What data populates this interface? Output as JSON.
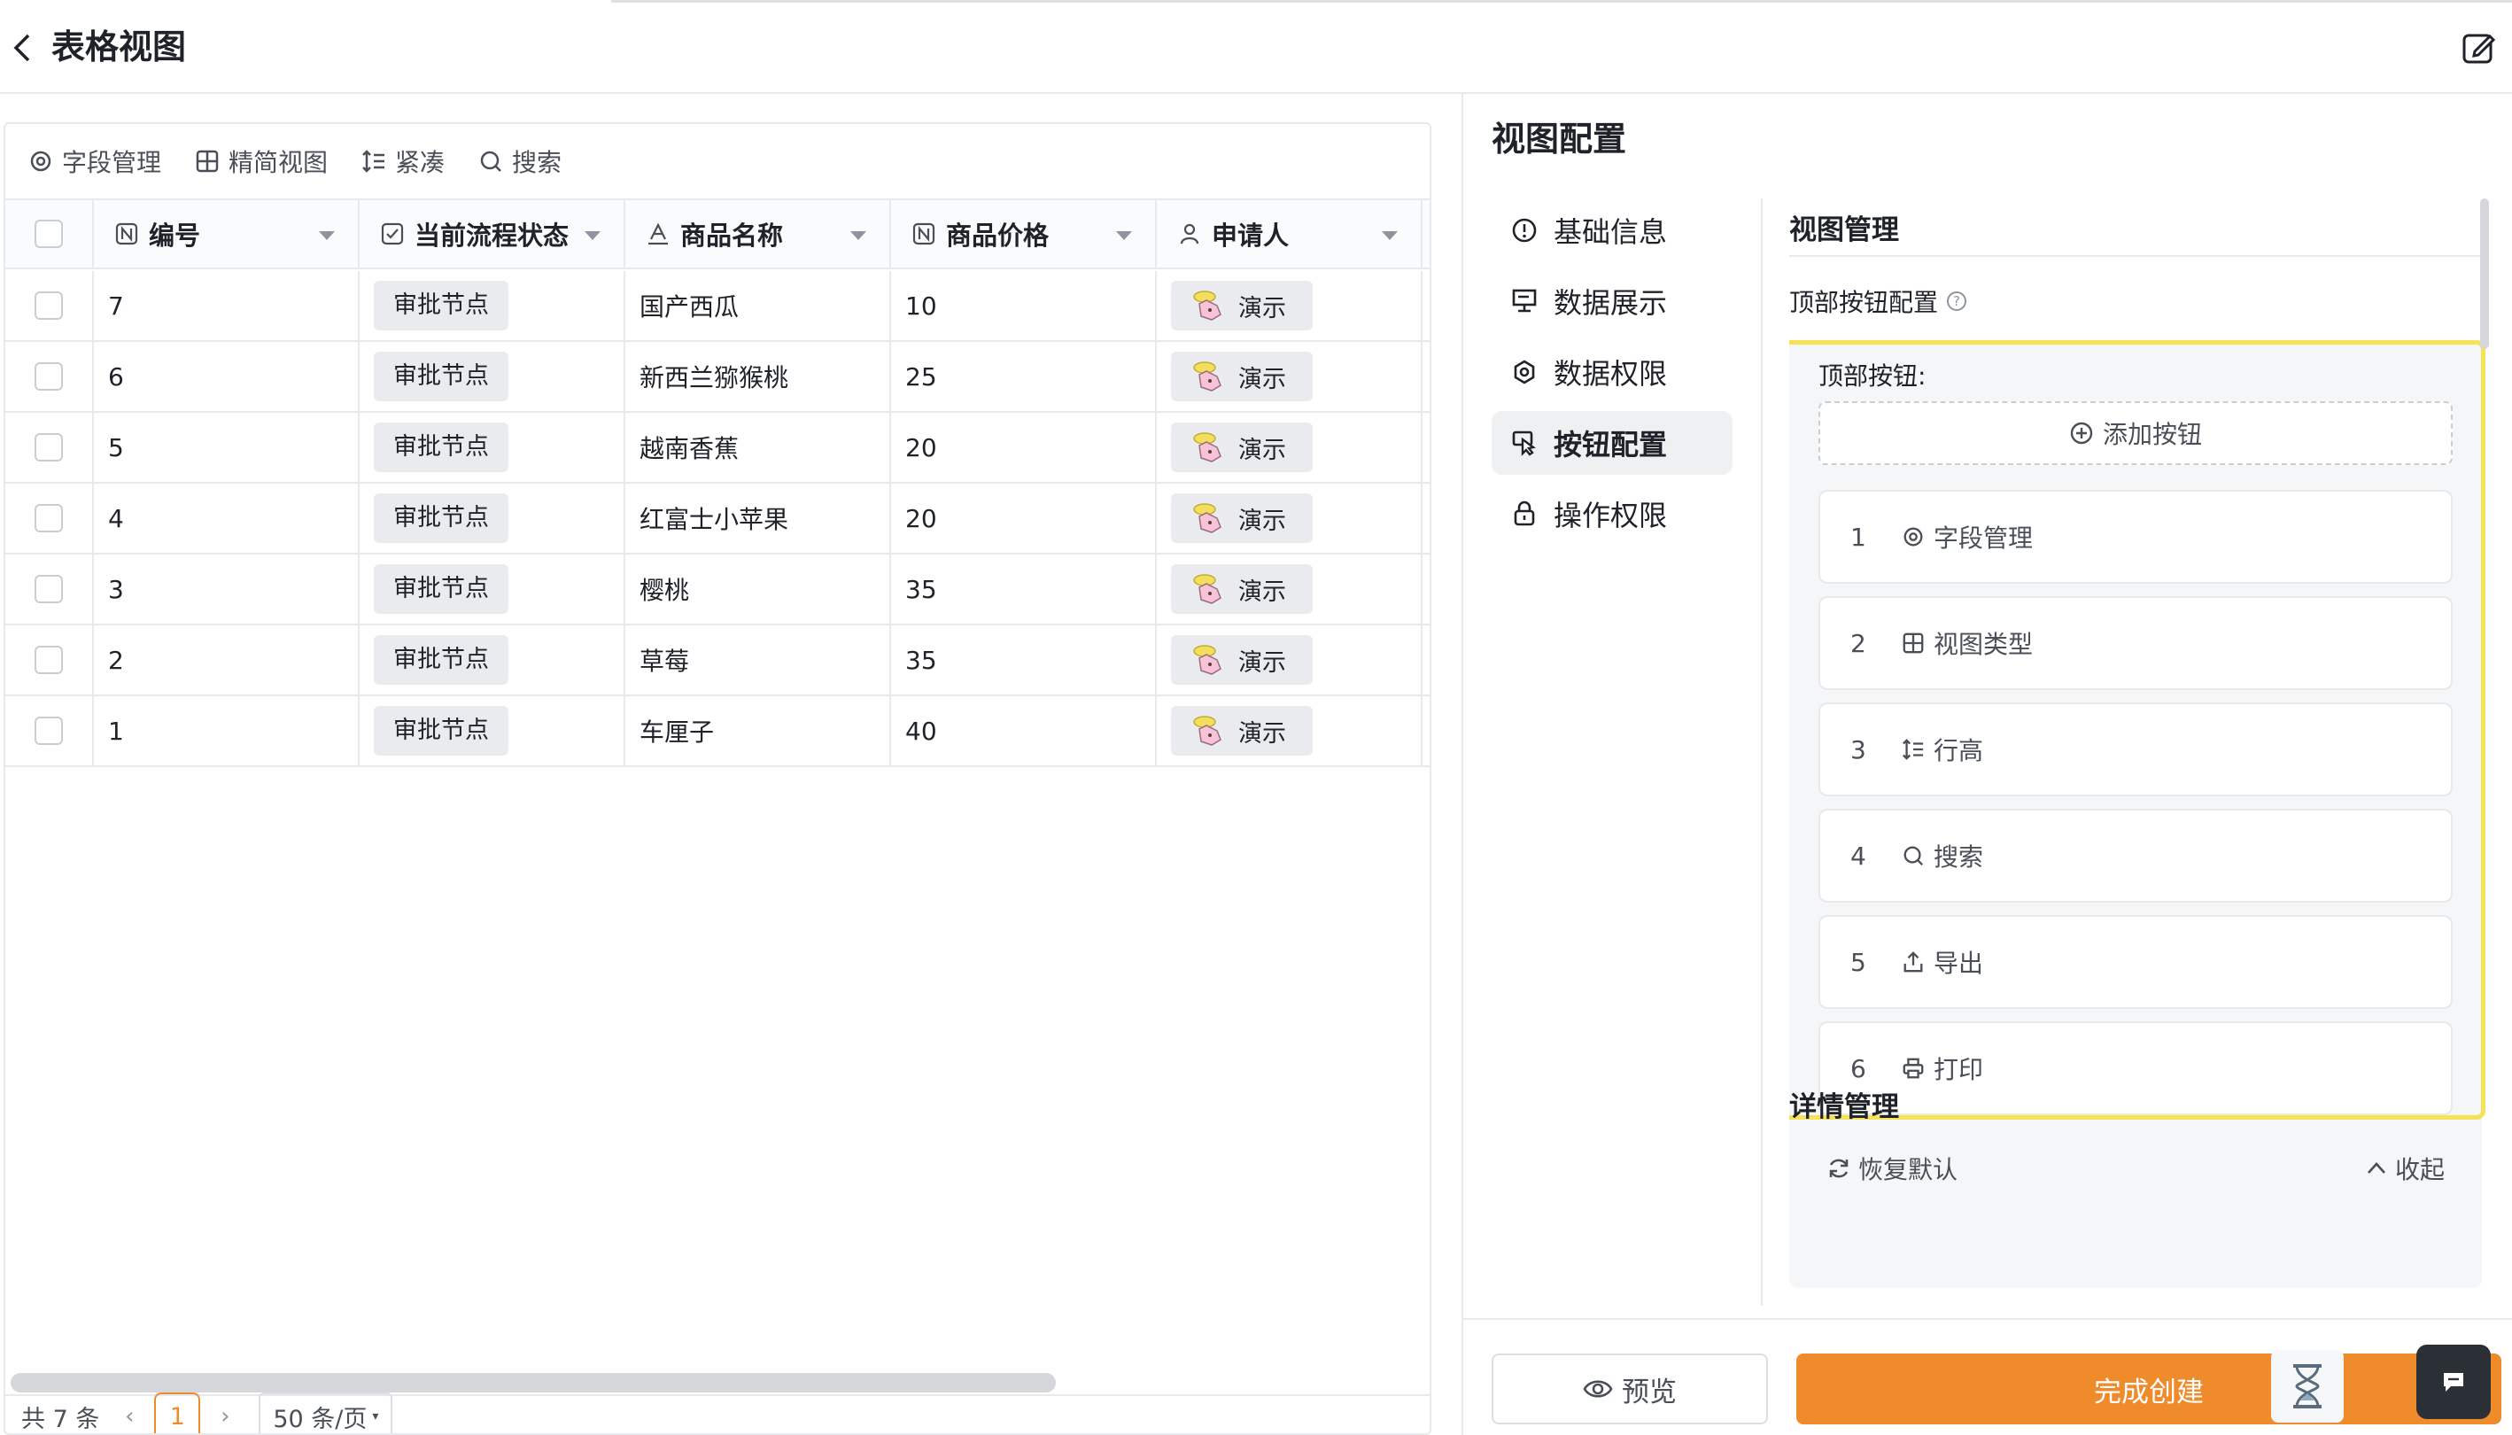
{
  "header": {
    "title": "表格视图"
  },
  "toolbar": {
    "items": [
      "字段管理",
      "精简视图",
      "紧凑",
      "搜索"
    ]
  },
  "table": {
    "columns": [
      "编号",
      "当前流程状态",
      "商品名称",
      "商品价格",
      "申请人"
    ],
    "rows": [
      {
        "id": "7",
        "status": "审批节点",
        "name": "国产西瓜",
        "price": "10",
        "applicant": "演示"
      },
      {
        "id": "6",
        "status": "审批节点",
        "name": "新西兰猕猴桃",
        "price": "25",
        "applicant": "演示"
      },
      {
        "id": "5",
        "status": "审批节点",
        "name": "越南香蕉",
        "price": "20",
        "applicant": "演示"
      },
      {
        "id": "4",
        "status": "审批节点",
        "name": "红富士小苹果",
        "price": "20",
        "applicant": "演示"
      },
      {
        "id": "3",
        "status": "审批节点",
        "name": "樱桃",
        "price": "35",
        "applicant": "演示"
      },
      {
        "id": "2",
        "status": "审批节点",
        "name": "草莓",
        "price": "35",
        "applicant": "演示"
      },
      {
        "id": "1",
        "status": "审批节点",
        "name": "车厘子",
        "price": "40",
        "applicant": "演示"
      }
    ]
  },
  "pager": {
    "total": "共 7 条",
    "current": "1",
    "size": "50 条/页"
  },
  "panel": {
    "title": "视图配置",
    "nav": [
      "基础信息",
      "数据展示",
      "数据权限",
      "按钮配置",
      "操作权限"
    ],
    "active_nav": "按钮配置",
    "section": "视图管理",
    "sub": "顶部按钮配置",
    "box_label": "顶部按钮:",
    "add_label": "添加按钮",
    "buttons": [
      {
        "num": "1",
        "label": "字段管理",
        "icon": "field-icon"
      },
      {
        "num": "2",
        "label": "视图类型",
        "icon": "grid-icon"
      },
      {
        "num": "3",
        "label": "行高",
        "icon": "row-height-icon"
      },
      {
        "num": "4",
        "label": "搜索",
        "icon": "search-icon"
      },
      {
        "num": "5",
        "label": "导出",
        "icon": "export-icon"
      },
      {
        "num": "6",
        "label": "打印",
        "icon": "print-icon"
      }
    ],
    "reset_label": "恢复默认",
    "collapse_label": "收起",
    "next_section": "详情管理",
    "preview_label": "预览",
    "done_label": "完成创建"
  },
  "colors": {
    "accent": "#f08b2c",
    "highlight": "#f5e256"
  }
}
